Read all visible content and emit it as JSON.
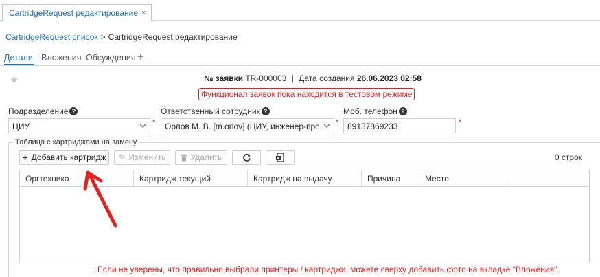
{
  "doc_tab": {
    "title": "CartridgeRequest редактирование",
    "close": "×"
  },
  "breadcrumb": {
    "parent": "CartridgeRequest список",
    "separator": ">",
    "current": "CartridgeRequest редактирование"
  },
  "subtabs": {
    "details": "Детали",
    "attachments": "Вложения",
    "discussions": "Обсуждения",
    "add": "+"
  },
  "header": {
    "number_label": "№ заявки",
    "number_value": "TR-000003",
    "divider": "|",
    "created_label": "Дата создания",
    "created_value": "26.06.2023 02:58",
    "notice": "Функционал заявок пока находится в тестовом режиме"
  },
  "form": {
    "department": {
      "label": "Подразделение",
      "value": "ЦИУ",
      "required": "*"
    },
    "responsible": {
      "label": "Ответственный сотрудник",
      "value": "Орлов М. В. [m.orlov] (ЦИУ, инженер-програі",
      "required": "*"
    },
    "phone": {
      "label": "Моб. телефон",
      "value": "89137869233",
      "required": "*"
    }
  },
  "table_section": {
    "legend": "Таблица с картриджами на замену",
    "buttons": {
      "add": "Добавить картридж",
      "edit": "Изменить",
      "delete": "Удалить"
    },
    "row_count": "0 строк",
    "columns": [
      "Оргтехника",
      "Картридж текущий",
      "Картридж на выдачу",
      "Причина",
      "Место"
    ]
  },
  "hint": "Если не уверены, что правильно выбрали принтеры / картриджи, можете сверху добавить фото на вкладке \"Вложения\".",
  "colors": {
    "accent": "#1a6fc4",
    "warning": "#e02020",
    "annotation_arrow": "#e8201c"
  }
}
